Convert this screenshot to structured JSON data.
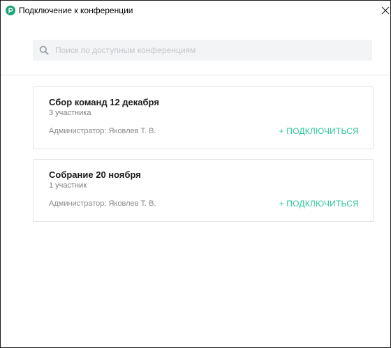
{
  "window": {
    "title": "Подключение к конференции",
    "close_label": "✕"
  },
  "search": {
    "placeholder": "Поиск по доступным конференциям",
    "value": ""
  },
  "conferences": [
    {
      "title": "Сбор команд 12 декабря",
      "participants": "3 участника",
      "admin": "Администратор: Яковлев Т. В.",
      "join_label": "+ ПОДКЛЮЧИТЬСЯ"
    },
    {
      "title": "Собрание 20 ноября",
      "participants": "1 участник",
      "admin": "Администратор: Яковлев Т. В.",
      "join_label": "+ ПОДКЛЮЧИТЬСЯ"
    }
  ],
  "colors": {
    "accent": "#2ec99a",
    "app_icon": "#1fa37a",
    "search_bg": "#f3f4f5"
  },
  "icons": {
    "app": "app-logo-icon",
    "search": "search-icon",
    "close": "close-icon"
  }
}
